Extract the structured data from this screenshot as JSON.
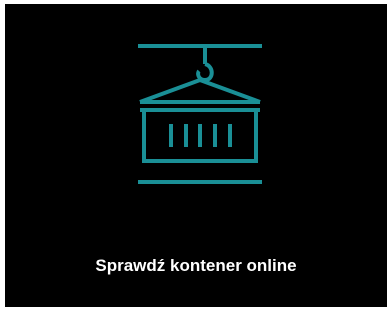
{
  "card": {
    "label": "Sprawdź kontener online",
    "icon": "container-crane-icon",
    "icon_color": "#1a8f96",
    "background": "#000000",
    "text_color": "#ffffff"
  }
}
